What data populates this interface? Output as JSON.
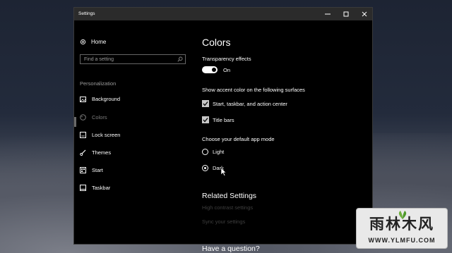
{
  "window": {
    "title": "Settings",
    "minimize_icon": "minimize-icon",
    "maximize_icon": "maximize-icon",
    "close_icon": "close-icon"
  },
  "sidebar": {
    "home_label": "Home",
    "search": {
      "placeholder": "Find a setting",
      "icon": "search-icon"
    },
    "section_label": "Personalization",
    "items": [
      {
        "label": "Background",
        "icon": "picture-icon"
      },
      {
        "label": "Colors",
        "icon": "palette-icon",
        "selected": true
      },
      {
        "label": "Lock screen",
        "icon": "lock-screen-icon"
      },
      {
        "label": "Themes",
        "icon": "brush-icon"
      },
      {
        "label": "Start",
        "icon": "start-icon"
      },
      {
        "label": "Taskbar",
        "icon": "taskbar-icon"
      }
    ]
  },
  "main": {
    "title": "Colors",
    "transparency": {
      "label": "Transparency effects",
      "state_text": "On",
      "on": true
    },
    "accent": {
      "label": "Show accent color on the following surfaces",
      "options": [
        {
          "label": "Start, taskbar, and action center",
          "checked": true
        },
        {
          "label": "Title bars",
          "checked": true
        }
      ]
    },
    "app_mode": {
      "label": "Choose your default app mode",
      "options": [
        {
          "label": "Light",
          "selected": false
        },
        {
          "label": "Dark",
          "selected": true
        }
      ]
    },
    "related": {
      "heading": "Related Settings",
      "links": [
        "High contrast settings",
        "Sync your settings"
      ]
    },
    "question_heading": "Have a question?"
  },
  "watermark": {
    "text": "雨林木风",
    "url": "WWW.YLMFU.COM"
  },
  "colors": {
    "window_bg": "#000000",
    "titlebar_bg": "#2b2b2b",
    "dim_text": "#3f3f3f",
    "watermark_bg": "#e9e9e9"
  }
}
